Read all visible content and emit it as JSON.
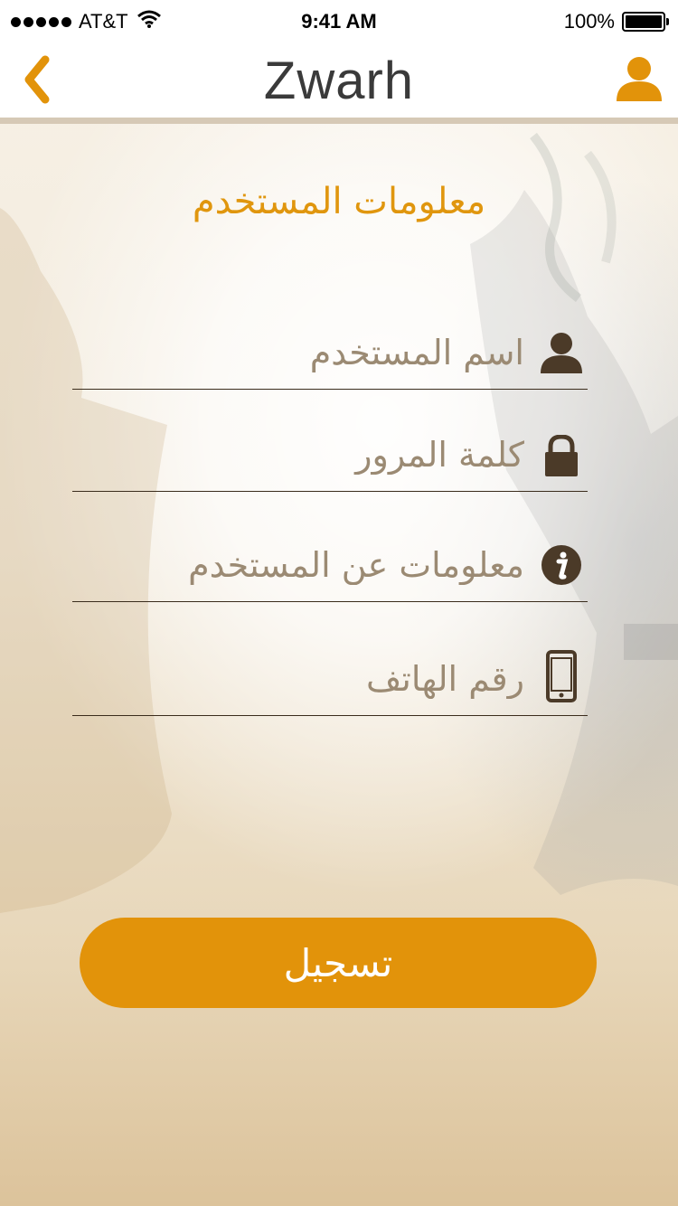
{
  "status_bar": {
    "carrier": "AT&T",
    "time": "9:41 AM",
    "battery": "100%"
  },
  "nav": {
    "logo": "Zwarh",
    "back_icon": "chevron-left-icon",
    "profile_icon": "user-icon"
  },
  "form": {
    "title": "معلومات المستخدم",
    "fields": [
      {
        "icon": "user-icon",
        "placeholder": "اسم المستخدم"
      },
      {
        "icon": "lock-icon",
        "placeholder": "كلمة المرور"
      },
      {
        "icon": "info-icon",
        "placeholder": "معلومات عن المستخدم"
      },
      {
        "icon": "phone-icon",
        "placeholder": "رقم الهاتف"
      }
    ],
    "submit_label": "تسجيل"
  },
  "colors": {
    "accent": "#e2930a",
    "icon_dark": "#4b3a28",
    "placeholder": "#9b8a73"
  }
}
